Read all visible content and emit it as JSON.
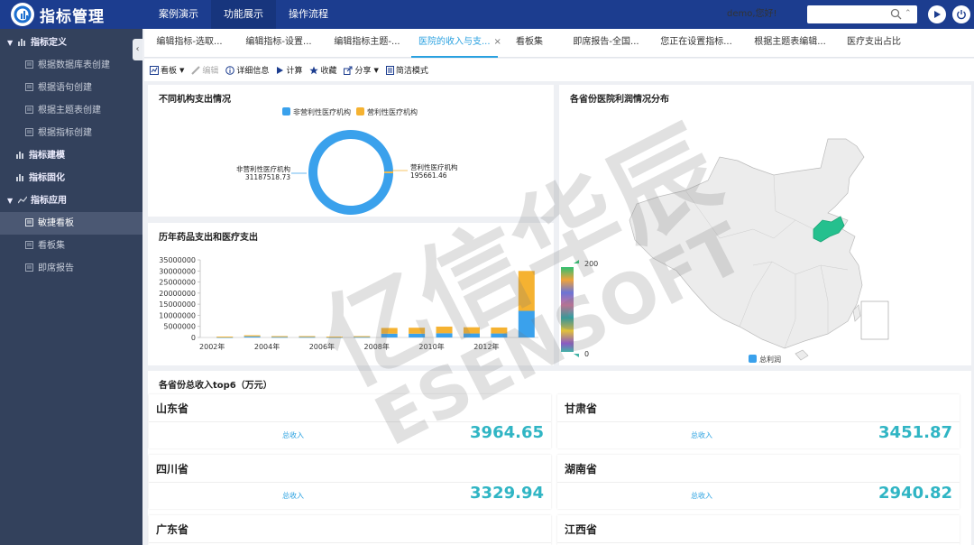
{
  "app": {
    "title": "指标管理"
  },
  "topnav": [
    "案例演示",
    "功能展示",
    "操作流程"
  ],
  "header": {
    "greeting": "demo,您好!"
  },
  "search": {
    "value": "",
    "placeholder": ""
  },
  "sidebar": {
    "items": [
      {
        "label": "指标定义",
        "kind": "group"
      },
      {
        "label": "根据数据库表创建",
        "kind": "sub"
      },
      {
        "label": "根据语句创建",
        "kind": "sub"
      },
      {
        "label": "根据主题表创建",
        "kind": "sub"
      },
      {
        "label": "根据指标创建",
        "kind": "sub"
      },
      {
        "label": "指标建模",
        "kind": "group"
      },
      {
        "label": "指标固化",
        "kind": "group"
      },
      {
        "label": "指标应用",
        "kind": "group"
      },
      {
        "label": "敏捷看板",
        "kind": "sub"
      },
      {
        "label": "看板集",
        "kind": "sub"
      },
      {
        "label": "即席报告",
        "kind": "sub"
      }
    ]
  },
  "tabs": [
    "编辑指标-选取...",
    "编辑指标-设置...",
    "编辑指标主题-...",
    "医院的收入与支...",
    "看板集",
    "即席报告-全国...",
    "您正在设置指标...",
    "根据主题表编辑...",
    "医疗支出占比"
  ],
  "tab_close": "×",
  "toolbar": {
    "board": "看板",
    "edit": "编辑",
    "detail": "详细信息",
    "calc": "计算",
    "fav": "收藏",
    "share": "分享",
    "simple": "简洁模式"
  },
  "donut": {
    "title": "不同机构支出情况",
    "legend": [
      "非营利性医疗机构",
      "营利性医疗机构"
    ],
    "label_left_name": "非营利性医疗机构",
    "label_left_value": "31187518.73",
    "label_right_name": "营利性医疗机构",
    "label_right_value": "195661.46",
    "colors": [
      "#3aa1ec",
      "#f5b231"
    ]
  },
  "map": {
    "title": "各省份医院利润情况分布",
    "scale_max": "200",
    "scale_min": "0",
    "legend": "总利润",
    "highlight_color": "#25c08e"
  },
  "kpi": {
    "title": "各省份总收入top6（万元）",
    "label": "总收入",
    "cards": [
      {
        "name": "山东省",
        "value": "3964.65"
      },
      {
        "name": "甘肃省",
        "value": "3451.87"
      },
      {
        "name": "四川省",
        "value": "3329.94"
      },
      {
        "name": "湖南省",
        "value": "2940.82"
      },
      {
        "name": "广东省",
        "value": ""
      },
      {
        "name": "江西省",
        "value": ""
      }
    ]
  },
  "watermark": {
    "text1": "亿信华辰",
    "text2": "ESENSOFT"
  },
  "chart_data": [
    {
      "type": "pie",
      "title": "不同机构支出情况",
      "categories": [
        "非营利性医疗机构",
        "营利性医疗机构"
      ],
      "values": [
        31187518.73,
        195661.46
      ],
      "legend": "top-center"
    },
    {
      "type": "bar",
      "title": "历年药品支出和医疗支出",
      "stacked": true,
      "x": [
        2002,
        2003,
        2004,
        2005,
        2006,
        2007,
        2008,
        2009,
        2010,
        2011,
        2012,
        2013
      ],
      "xticks": [
        "2002年",
        "2004年",
        "2006年",
        "2008年",
        "2010年",
        "2012年"
      ],
      "yticks": [
        "35000000",
        "30000000",
        "25000000",
        "20000000",
        "15000000",
        "10000000",
        "5000000",
        "0"
      ],
      "ylim": [
        0,
        35000000
      ],
      "series": [
        {
          "values": [
            200000,
            500000,
            300000,
            300000,
            200000,
            300000,
            1700000,
            1700000,
            1900000,
            1800000,
            1800000,
            12000000
          ],
          "color": "#3aa1ec"
        },
        {
          "values": [
            200000,
            500000,
            300000,
            300000,
            200000,
            300000,
            2600000,
            2700000,
            3000000,
            2800000,
            2700000,
            18000000
          ],
          "color": "#f5b231"
        }
      ]
    }
  ]
}
